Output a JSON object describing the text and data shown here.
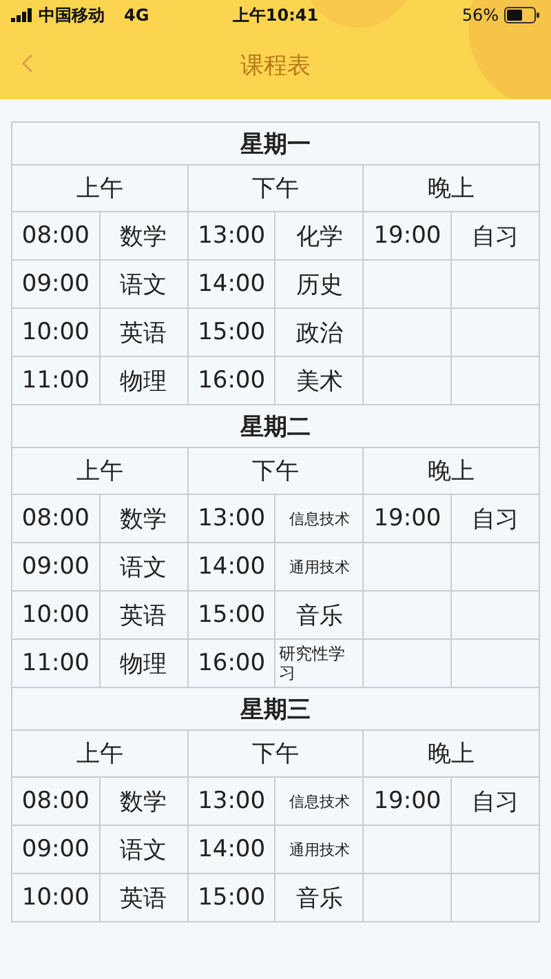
{
  "status_bar": {
    "carrier": "中国移动",
    "network": "4G",
    "time": "上午10:41",
    "battery": "56%"
  },
  "nav": {
    "title": "课程表"
  },
  "days": [
    {
      "name": "星期一",
      "periods": [
        "上午",
        "下午",
        "晚上"
      ],
      "rows": [
        {
          "slots": [
            {
              "time": "08:00",
              "subject": "数学"
            },
            {
              "time": "13:00",
              "subject": "化学"
            },
            {
              "time": "19:00",
              "subject": "自习"
            }
          ]
        },
        {
          "slots": [
            {
              "time": "09:00",
              "subject": "语文"
            },
            {
              "time": "14:00",
              "subject": "历史"
            }
          ]
        },
        {
          "slots": [
            {
              "time": "10:00",
              "subject": "英语"
            },
            {
              "time": "15:00",
              "subject": "政治"
            }
          ]
        },
        {
          "slots": [
            {
              "time": "11:00",
              "subject": "物理"
            },
            {
              "time": "16:00",
              "subject": "美术"
            }
          ]
        }
      ]
    },
    {
      "name": "星期二",
      "periods": [
        "上午",
        "下午",
        "晚上"
      ],
      "rows": [
        {
          "slots": [
            {
              "time": "08:00",
              "subject": "数学"
            },
            {
              "time": "13:00",
              "subject": "信息技术"
            },
            {
              "time": "19:00",
              "subject": "自习"
            }
          ]
        },
        {
          "slots": [
            {
              "time": "09:00",
              "subject": "语文"
            },
            {
              "time": "14:00",
              "subject": "通用技术"
            }
          ]
        },
        {
          "slots": [
            {
              "time": "10:00",
              "subject": "英语"
            },
            {
              "time": "15:00",
              "subject": "音乐"
            }
          ]
        },
        {
          "slots": [
            {
              "time": "11:00",
              "subject": "物理"
            },
            {
              "time": "16:00",
              "subject": "研究性学习"
            }
          ]
        }
      ]
    },
    {
      "name": "星期三",
      "periods": [
        "上午",
        "下午",
        "晚上"
      ],
      "rows": [
        {
          "slots": [
            {
              "time": "08:00",
              "subject": "数学"
            },
            {
              "time": "13:00",
              "subject": "信息技术"
            },
            {
              "time": "19:00",
              "subject": "自习"
            }
          ]
        },
        {
          "slots": [
            {
              "time": "09:00",
              "subject": "语文"
            },
            {
              "time": "14:00",
              "subject": "通用技术"
            }
          ]
        },
        {
          "slots": [
            {
              "time": "10:00",
              "subject": "英语"
            },
            {
              "time": "15:00",
              "subject": "音乐"
            }
          ]
        }
      ]
    }
  ]
}
